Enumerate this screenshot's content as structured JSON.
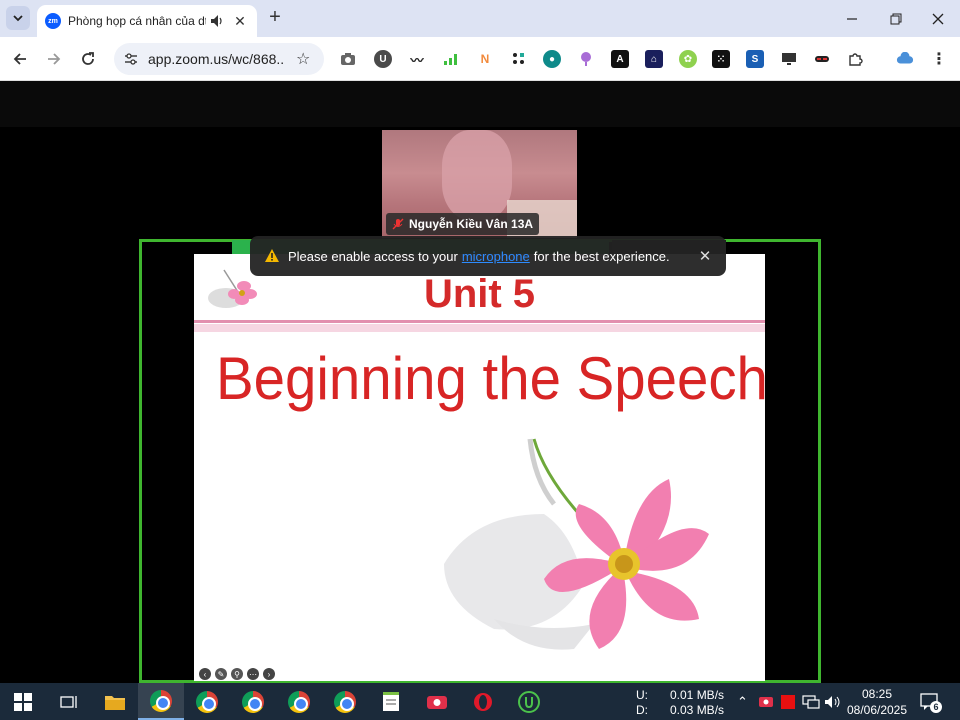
{
  "browser": {
    "tab_title": "Phòng họp cá nhân của dtt",
    "favicon_text": "zm",
    "url": "app.zoom.us/wc/868...",
    "extensions": [
      "camera-icon",
      "ublock-icon",
      "wave-icon",
      "bars-icon",
      "n-icon",
      "grid-icon",
      "turtle-icon",
      "pin-icon",
      "a-icon",
      "house-icon",
      "clover-icon",
      "dice-icon",
      "s-icon",
      "monitor-icon",
      "mask-icon",
      "puzzle-icon",
      "cloud-icon"
    ]
  },
  "meeting": {
    "participant_name": "Nguyễn Kiều Vân 13A",
    "toast": {
      "before": "Please enable access to your",
      "link": "microphone",
      "after": "for the best experience."
    }
  },
  "slide": {
    "unit": "Unit 5",
    "title": "Beginning the Speech"
  },
  "taskbar": {
    "net_up_label": "U:",
    "net_up_value": "0.01 MB/s",
    "net_down_label": "D:",
    "net_down_value": "0.03 MB/s",
    "time": "08:25",
    "date": "08/06/2025",
    "notification_count": "6"
  },
  "colors": {
    "zoom_blue": "#0b5cff",
    "share_green": "#3fb52f",
    "slide_red": "#d42a2a"
  }
}
